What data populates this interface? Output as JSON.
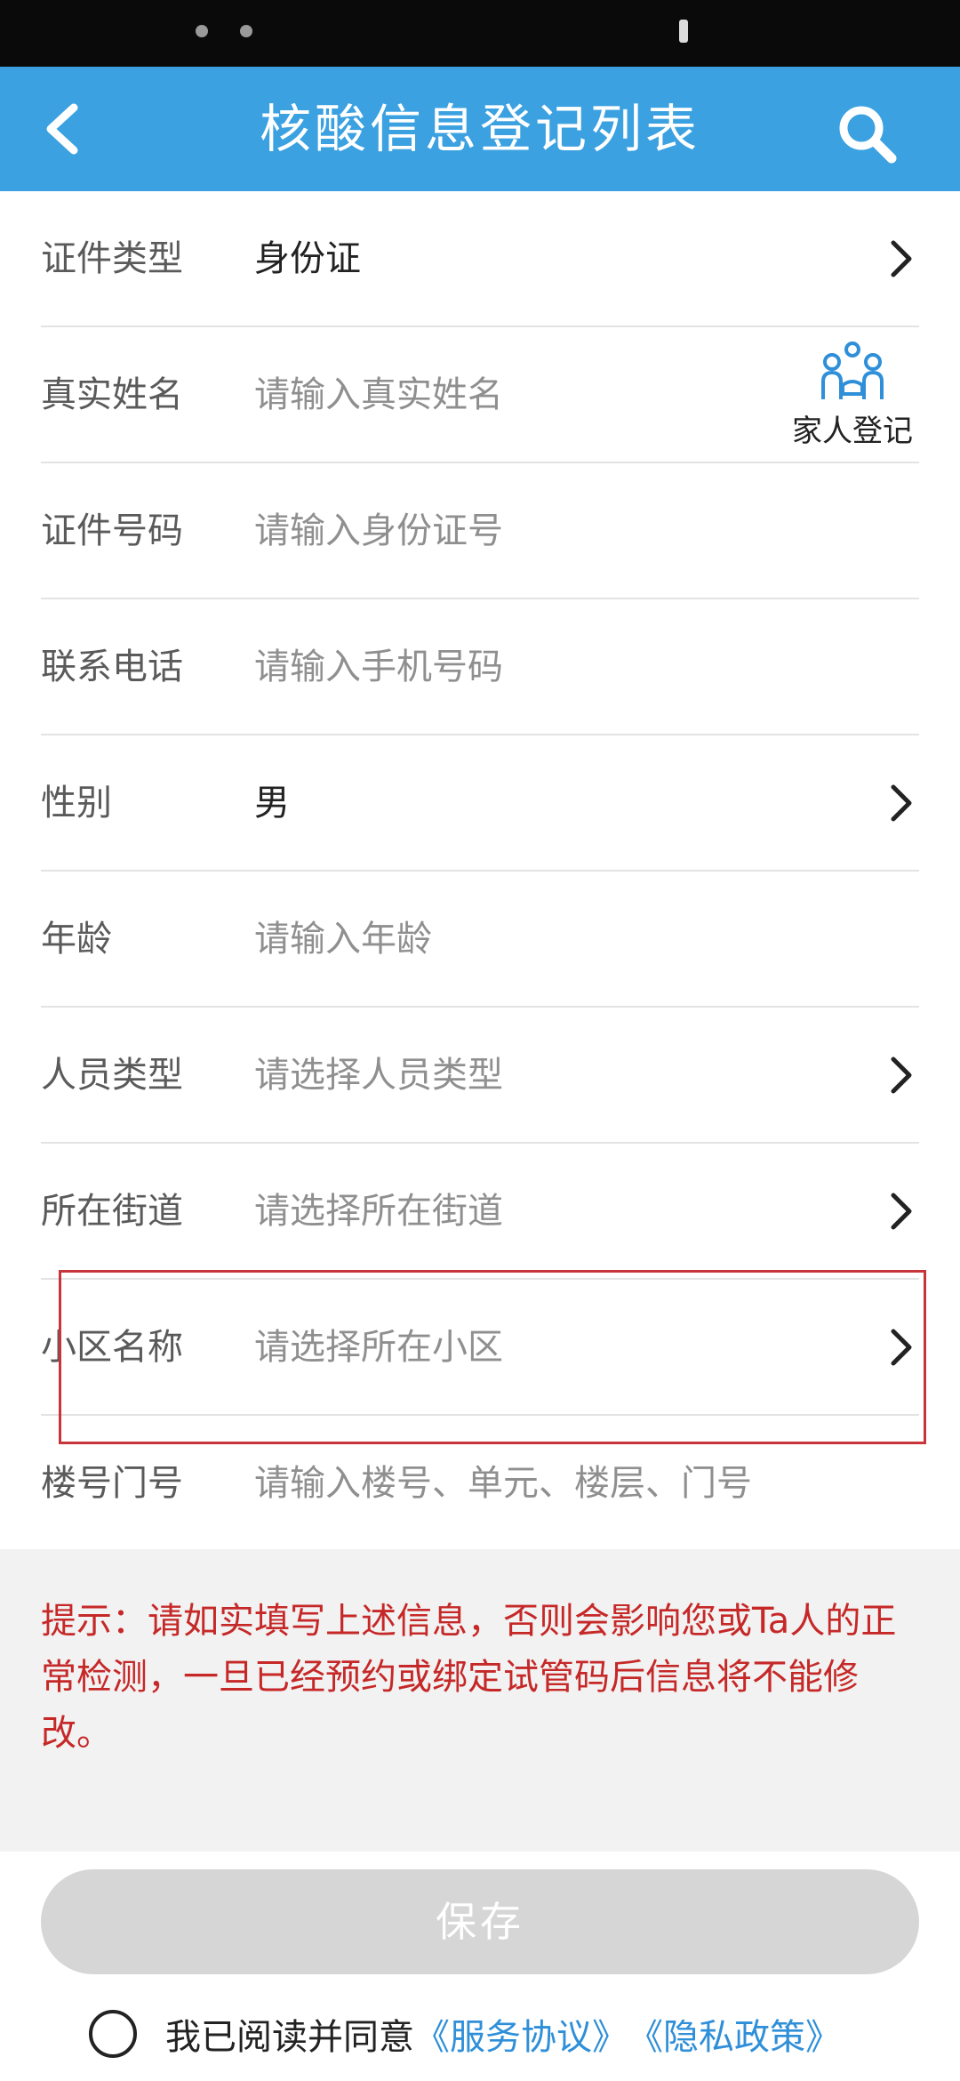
{
  "nav": {
    "title": "核酸信息登记列表"
  },
  "form": {
    "rows": [
      {
        "label": "证件类型",
        "value": "身份证",
        "placeholder": ""
      },
      {
        "label": "真实姓名",
        "value": "",
        "placeholder": "请输入真实姓名"
      },
      {
        "label": "证件号码",
        "value": "",
        "placeholder": "请输入身份证号"
      },
      {
        "label": "联系电话",
        "value": "",
        "placeholder": "请输入手机号码"
      },
      {
        "label": "性别",
        "value": "男",
        "placeholder": ""
      },
      {
        "label": "年龄",
        "value": "",
        "placeholder": "请输入年龄"
      },
      {
        "label": "人员类型",
        "value": "",
        "placeholder": "请选择人员类型"
      },
      {
        "label": "所在街道",
        "value": "",
        "placeholder": "请选择所在街道"
      },
      {
        "label": "小区名称",
        "value": "",
        "placeholder": "请选择所在小区"
      },
      {
        "label": "楼号门号",
        "value": "",
        "placeholder": "请输入楼号、单元、楼层、门号"
      }
    ],
    "family_register_label": "家人登记"
  },
  "tip": {
    "text": "提示：请如实填写上述信息，否则会影响您或Ta人的正常检测，一旦已经预约或绑定试管码后信息将不能修改。"
  },
  "save_label": "保存",
  "agreement": {
    "prefix": "我已阅读并同意",
    "service_link": "《服务协议》",
    "privacy_link": "《隐私政策》"
  },
  "colors": {
    "nav_bg": "#3ba1e1",
    "tip_text": "#c62828",
    "link": "#2f8fd8",
    "highlight_box": "#c7343a"
  }
}
